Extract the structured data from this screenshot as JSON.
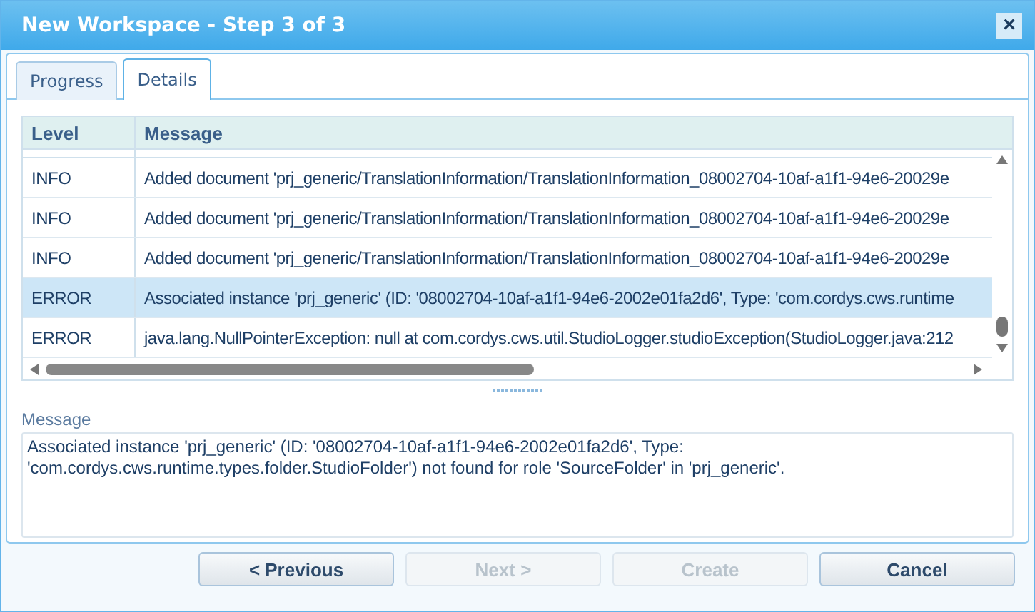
{
  "window": {
    "title": "New Workspace - Step 3 of 3",
    "close": "×"
  },
  "tabs": [
    {
      "label": "Progress",
      "selected": false
    },
    {
      "label": "Details",
      "selected": true
    }
  ],
  "table": {
    "columns": [
      "Level",
      "Message"
    ],
    "rows": [
      {
        "level": "INFO",
        "message": "Added document 'prj_generic/TranslationInformation/TranslationInformation_08002704-10af-a1f1-94e6-20029e",
        "selected": false
      },
      {
        "level": "INFO",
        "message": "Added document 'prj_generic/TranslationInformation/TranslationInformation_08002704-10af-a1f1-94e6-20029e",
        "selected": false
      },
      {
        "level": "INFO",
        "message": "Added document 'prj_generic/TranslationInformation/TranslationInformation_08002704-10af-a1f1-94e6-20029e",
        "selected": false
      },
      {
        "level": "ERROR",
        "message": "Associated instance 'prj_generic' (ID: '08002704-10af-a1f1-94e6-2002e01fa2d6', Type: 'com.cordys.cws.runtime",
        "selected": true
      },
      {
        "level": "ERROR",
        "message": "java.lang.NullPointerException: null at com.cordys.cws.util.StudioLogger.studioException(StudioLogger.java:212",
        "selected": false
      }
    ]
  },
  "message": {
    "label": "Message",
    "value": "Associated instance 'prj_generic' (ID: '08002704-10af-a1f1-94e6-2002e01fa2d6', Type: 'com.cordys.cws.runtime.types.folder.StudioFolder') not found for role 'SourceFolder' in 'prj_generic'."
  },
  "buttons": [
    {
      "label": "< Previous",
      "disabled": false
    },
    {
      "label": "Next >",
      "disabled": true
    },
    {
      "label": "Create",
      "disabled": true
    },
    {
      "label": "Cancel",
      "disabled": false
    }
  ]
}
